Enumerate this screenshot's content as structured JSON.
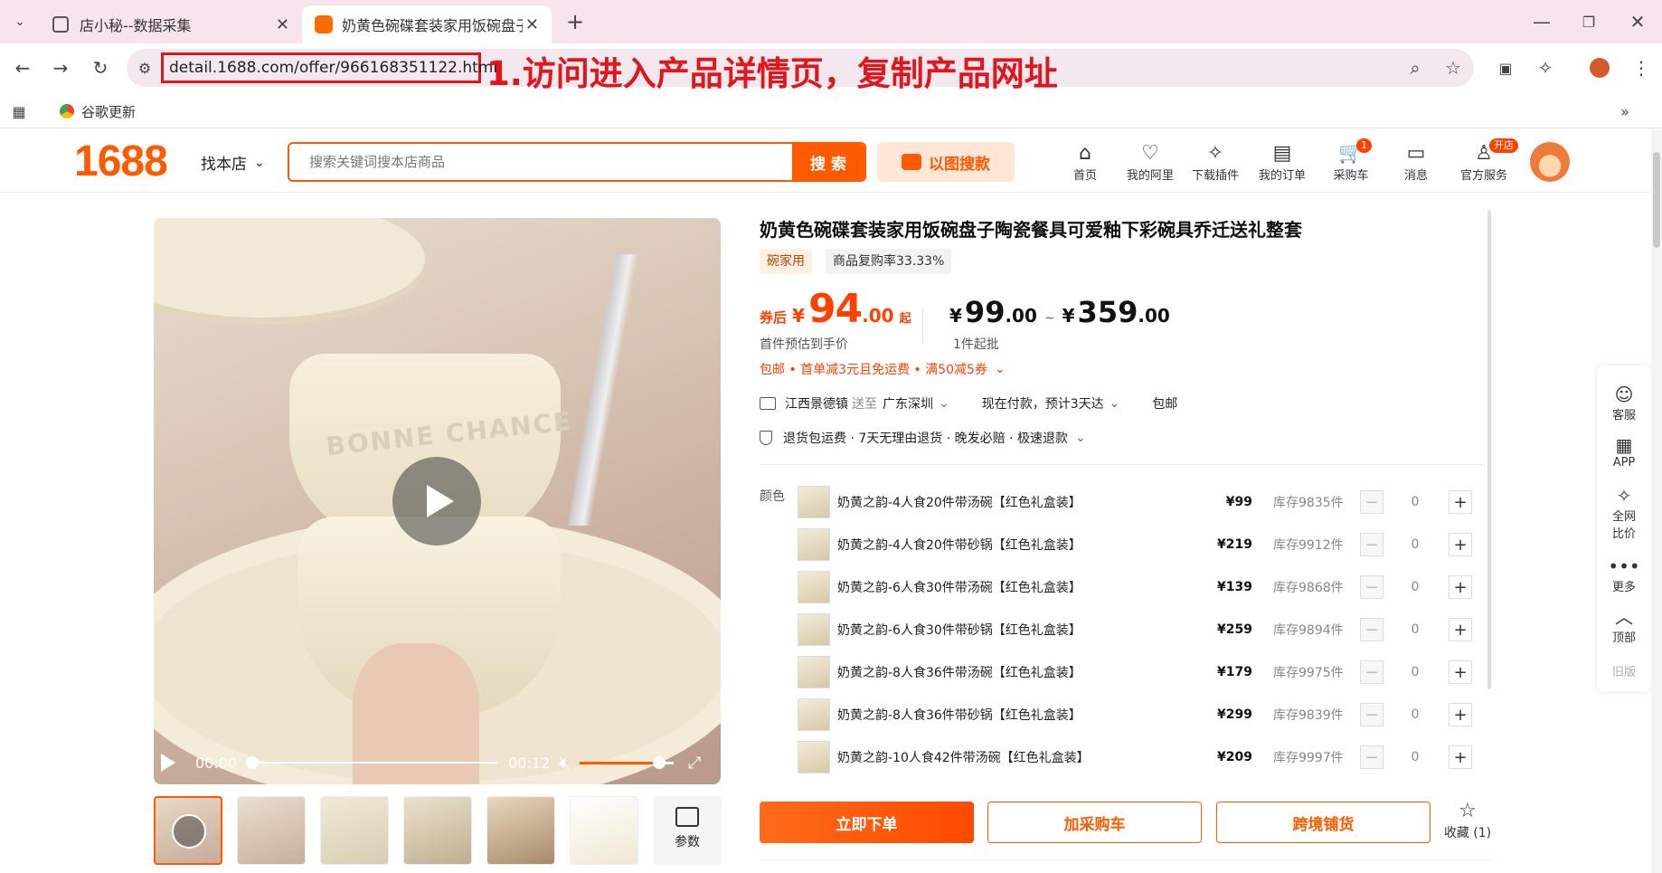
{
  "browser": {
    "tabs": [
      {
        "title": "店小秘--数据采集"
      },
      {
        "title": "奶黄色碗碟套装家用饭碗盘子陶"
      }
    ],
    "new_tab": "+",
    "url": "detail.1688.com/offer/966168351122.html",
    "annotation": "1.访问进入产品详情页，复制产品网址",
    "bookmark": "谷歌更新"
  },
  "site": {
    "logo": "1688",
    "shop_dropdown": "找本店",
    "search_placeholder": "搜索关键词搜本店商品",
    "search_button": "搜 索",
    "image_search": "以图搜款",
    "nav": [
      {
        "label": "首页",
        "icon": "home-icon",
        "glyph": "⌂"
      },
      {
        "label": "我的阿里",
        "icon": "heart-shield-icon",
        "glyph": "♡"
      },
      {
        "label": "下载插件",
        "icon": "puzzle-icon",
        "glyph": "✧"
      },
      {
        "label": "我的订单",
        "icon": "clipboard-icon",
        "glyph": "▤"
      },
      {
        "label": "采购车",
        "icon": "cart-icon",
        "glyph": "🛒",
        "badge": "1"
      },
      {
        "label": "消息",
        "icon": "message-icon",
        "glyph": "▭"
      },
      {
        "label": "官方服务",
        "icon": "person-icon",
        "glyph": "♙",
        "badge": "开店"
      }
    ]
  },
  "product": {
    "title": "奶黄色碗碟套装家用饭碗盘子陶瓷餐具可爱釉下彩碗具乔迁送礼整套",
    "tags": [
      "碗家用",
      "商品复购率33.33%"
    ],
    "coupon_label": "券后",
    "currency": "¥",
    "coupon_price_int": "94",
    "coupon_price_dec": ".00",
    "coupon_suffix": "起",
    "coupon_note": "首件预估到手价",
    "range_low_int": "99",
    "range_low_dec": ".00",
    "range_sep": "~",
    "range_high_int": "359",
    "range_high_dec": ".00",
    "min_order": "1件起批",
    "promo": "包邮 • 首单减3元且免运费 • 满50减5券",
    "shipping_from": "江西景德镇",
    "ship_to_label": "送至",
    "ship_to": "广东深圳",
    "delivery": "现在付款，预计3天达",
    "free_ship": "包邮",
    "guarantees": "退货包运费 · 7天无理由退货 · 晚发必赔 · 极速退款",
    "color_label": "颜色",
    "skus": [
      {
        "name": "奶黄之韵-4人食20件带汤碗【红色礼盒装】",
        "price": "¥99",
        "stock": "库存9835件",
        "qty": "0"
      },
      {
        "name": "奶黄之韵-4人食20件带砂锅【红色礼盒装】",
        "price": "¥219",
        "stock": "库存9912件",
        "qty": "0"
      },
      {
        "name": "奶黄之韵-6人食30件带汤碗【红色礼盒装】",
        "price": "¥139",
        "stock": "库存9868件",
        "qty": "0"
      },
      {
        "name": "奶黄之韵-6人食30件带砂锅【红色礼盒装】",
        "price": "¥259",
        "stock": "库存9894件",
        "qty": "0"
      },
      {
        "name": "奶黄之韵-8人食36件带汤碗【红色礼盒装】",
        "price": "¥179",
        "stock": "库存9975件",
        "qty": "0"
      },
      {
        "name": "奶黄之韵-8人食36件带砂锅【红色礼盒装】",
        "price": "¥299",
        "stock": "库存9839件",
        "qty": "0"
      },
      {
        "name": "奶黄之韵-10人食42件带汤碗【红色礼盒装】",
        "price": "¥209",
        "stock": "库存9997件",
        "qty": "0"
      }
    ],
    "buy_now": "立即下单",
    "add_cart": "加采购车",
    "cross_border": "跨境铺货",
    "favorite": "收藏 (1)",
    "video": {
      "current": "00:00",
      "duration": "00:12",
      "progress": 0.0,
      "volume": 0.85,
      "text_on_bowl": "BONNE CHANCE"
    },
    "params_label": "参数"
  },
  "sidebar": [
    {
      "label": "客服",
      "icon": "chat-bot-icon",
      "glyph": "☺"
    },
    {
      "label": "APP",
      "icon": "qr-icon",
      "glyph": "▦"
    },
    {
      "label": "全网\n比价",
      "icon": "compare-icon",
      "glyph": "✧"
    },
    {
      "label": "更多",
      "icon": "more-icon",
      "glyph": "•••"
    },
    {
      "label": "顶部",
      "icon": "top-icon",
      "glyph": "︿"
    },
    {
      "label": "旧版",
      "icon": "",
      "glyph": ""
    }
  ],
  "colors": {
    "brand": "#ff5a00",
    "price": "#ff4000",
    "tab_bg": "#f8e4ec",
    "annotation": "#e0161e"
  }
}
